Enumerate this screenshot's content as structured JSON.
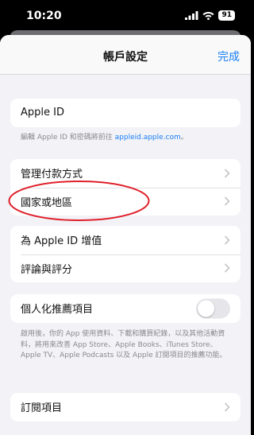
{
  "status_bar": {
    "time": "10:20",
    "battery": "91"
  },
  "nav": {
    "title": "帳戶設定",
    "done_label": "完成"
  },
  "apple_id": {
    "label": "Apple ID"
  },
  "apple_id_note": {
    "prefix": "編輯 Apple ID 和密碼將前往 ",
    "link": "appleid.apple.com",
    "suffix": "。"
  },
  "payment_group": {
    "items": [
      {
        "label": "管理付款方式"
      },
      {
        "label": "國家或地區"
      }
    ]
  },
  "credit_group": {
    "items": [
      {
        "label": "為 Apple ID 增值"
      },
      {
        "label": "評論與評分"
      }
    ]
  },
  "personalization": {
    "label": "個人化推薦項目",
    "enabled": false
  },
  "personalization_note": "啟用後，你的 App 使用資料、下載和購買紀錄，以及其他活動資料，將用來改善 App Store、Apple Books、iTunes Store、Apple TV、Apple Podcasts 以及 Apple 訂閱項目的推薦功能。",
  "subscriptions": {
    "label": "訂閱項目"
  },
  "annotation": {
    "color": "#e0202a"
  }
}
